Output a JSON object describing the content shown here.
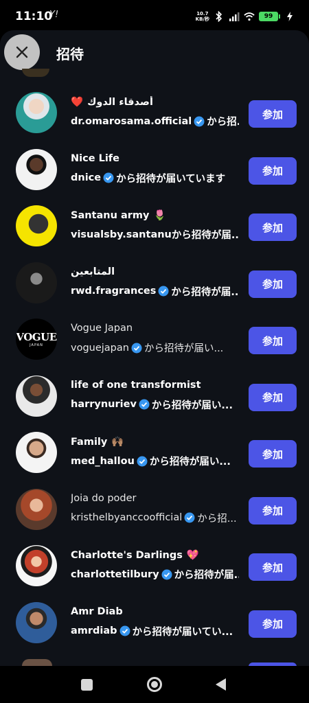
{
  "status_bar": {
    "time": "11:10",
    "carrier": "Y!",
    "net_speed_value": "10.7",
    "net_speed_unit": "KB/秒",
    "battery": "99"
  },
  "header": {
    "title": "招待"
  },
  "join_label": "参加",
  "invites": [
    {
      "name": "أصدقاء الدوك",
      "name_emoji": "❤️",
      "sender": "dr.omarosama.official",
      "verified": true,
      "suffix": "から招...",
      "bold": true
    },
    {
      "name": "Nice Life",
      "name_emoji": "",
      "sender": "dnice",
      "verified": true,
      "suffix": "から招待が届いています",
      "bold": true
    },
    {
      "name": "Santanu army",
      "name_emoji": "🌷",
      "sender": "visualsby.santanu",
      "verified": false,
      "suffix": "から招待が届...",
      "bold": true
    },
    {
      "name": "المتابعين",
      "name_emoji": "",
      "sender": "rwd.fragrances",
      "verified": true,
      "suffix": "から招待が届...",
      "bold": true
    },
    {
      "name": "Vogue Japan",
      "name_emoji": "",
      "sender": "voguejapan",
      "verified": true,
      "suffix": "から招待が届い...",
      "bold": false
    },
    {
      "name": "life of one transformist",
      "name_emoji": "",
      "sender": "harrynuriev",
      "verified": true,
      "suffix": "から招待が届い...",
      "bold": true
    },
    {
      "name": "Family",
      "name_emoji": "🙌🏽",
      "sender": "med_hallou",
      "verified": true,
      "suffix": "から招待が届い...",
      "bold": true
    },
    {
      "name": "Joia do poder",
      "name_emoji": "",
      "sender": "kristhelbyanccoofficial",
      "verified": true,
      "suffix": "から招...",
      "bold": false
    },
    {
      "name": "Charlotte's Darlings",
      "name_emoji": "💖",
      "sender": "charlottetilbury",
      "verified": true,
      "suffix": "から招待が届...",
      "bold": true
    },
    {
      "name": "Amr Diab",
      "name_emoji": "",
      "sender": "amrdiab",
      "verified": true,
      "suffix": "から招待が届いてい...",
      "bold": true
    }
  ],
  "avatars": {
    "vogue_text": "VOGUE",
    "vogue_sub": "JAPAN"
  },
  "colors": {
    "join_button": "#4c55e6",
    "sheet_bg": "#0f1218",
    "verified": "#3897f0"
  }
}
